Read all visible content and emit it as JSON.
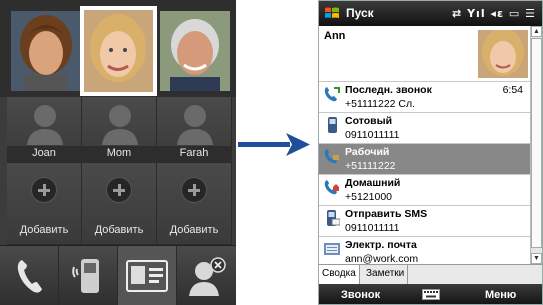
{
  "left_device": {
    "contacts": [
      {
        "name": "Joan",
        "icon": "silhouette-icon"
      },
      {
        "name": "Mom",
        "icon": "silhouette-icon"
      },
      {
        "name": "Farah",
        "icon": "silhouette-icon"
      }
    ],
    "add_slots": [
      {
        "label": "Добавить",
        "icon": "plus-icon"
      },
      {
        "label": "Добавить",
        "icon": "plus-icon"
      },
      {
        "label": "Добавить",
        "icon": "plus-icon"
      }
    ],
    "actions": [
      "phone-icon",
      "mobile-device-icon",
      "contact-card-icon",
      "remove-contact-icon"
    ]
  },
  "phone": {
    "title": "Пуск",
    "status_icons": "⇄ Yıl ◂ε ▭ ☰",
    "contact_name": "Ann",
    "details": [
      {
        "title": "Последн. звонок",
        "value": "+51111222 Сл.",
        "time": "6:54",
        "icon": "call-log-icon"
      },
      {
        "title": "Сотовый",
        "value": "0911011111",
        "icon": "mobile-phone-icon"
      },
      {
        "title": "Рабочий",
        "value": "+51111222",
        "icon": "work-phone-icon"
      },
      {
        "title": "Домашний",
        "value": "+5121000",
        "icon": "home-phone-icon"
      },
      {
        "title": "Отправить SMS",
        "value": "0911011111",
        "icon": "sms-icon"
      },
      {
        "title": "Электр. почта",
        "value": "ann@work.com",
        "icon": "email-icon"
      }
    ],
    "tabs": [
      "Сводка",
      "Заметки"
    ],
    "softkeys": {
      "left": "Звонок",
      "right": "Меню"
    }
  },
  "colors": {
    "highlight": "#888888",
    "arrow": "#1f4e9b"
  }
}
